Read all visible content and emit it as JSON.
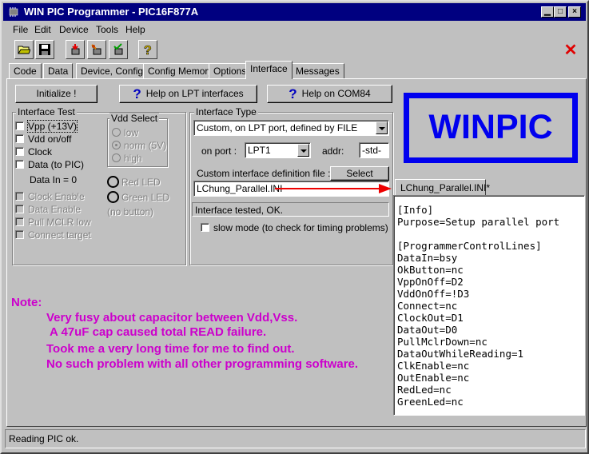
{
  "window": {
    "title": "WIN PIC Programmer - PIC16F877A"
  },
  "menu": [
    "File",
    "Edit",
    "Device",
    "Tools",
    "Help"
  ],
  "toolbar": {
    "icons": [
      "open-folder-icon",
      "save-disk-icon",
      "chip-read-icon",
      "chip-program-icon",
      "chip-verify-icon",
      "help-question-icon"
    ],
    "close_glyph": "✕"
  },
  "tabs": [
    "Code",
    "Data",
    "Device, Config",
    "Config Memory",
    "Options",
    "Interface",
    "Messages"
  ],
  "active_tab": "Interface",
  "buttons": {
    "initialize": "Initialize !",
    "help_lpt": "Help on LPT interfaces",
    "help_com": "Help on COM84",
    "select": "Select"
  },
  "interface_test": {
    "title": "Interface Test",
    "checks": [
      "Vpp (+13V)",
      "Vdd on/off",
      "Clock",
      "Data (to PIC)"
    ],
    "data_in": "Data In = 0",
    "disabled_checks": [
      "Clock Enable",
      "Data Enable",
      "Pull MCLR low",
      "Connect target"
    ]
  },
  "vdd_select": {
    "title": "Vdd Select",
    "options": [
      "low",
      "norm (5V)",
      "high"
    ],
    "selected": "norm (5V)"
  },
  "leds": {
    "red": "Red LED",
    "green": "Green LED",
    "no_button": "(no button)"
  },
  "interface_type": {
    "title": "Interface Type",
    "type_value": "Custom, on LPT port, defined by FILE",
    "on_port_label": "on port :",
    "port_value": "LPT1",
    "addr_label": "addr:",
    "addr_value": "-std-",
    "def_file_label": "Custom interface definition file :",
    "def_file_value": "LChung_Parallel.INI",
    "status": "Interface tested, OK.",
    "slow_mode": "slow mode (to check for timing problems)"
  },
  "logo": "WINPIC",
  "ini_tab": "LChung_Parallel.INI*",
  "ini_lines": [
    "[Info]",
    "Purpose=Setup parallel port",
    "",
    "[ProgrammerControlLines]",
    "DataIn=bsy",
    "OkButton=nc",
    "VppOnOff=D2",
    "VddOnOff=!D3",
    "Connect=nc",
    "ClockOut=D1",
    "DataOut=D0",
    "PullMclrDown=nc",
    "DataOutWhileReading=1",
    "ClkEnable=nc",
    "OutEnable=nc",
    "RedLed=nc",
    "GreenLed=nc"
  ],
  "note": {
    "title": "Note:",
    "lines": [
      "Very fusy about capacitor between Vdd,Vss.",
      "A 47uF cap caused total READ failure.",
      "Took me a very long time for me to find out.",
      "No such problem with all other programming software."
    ]
  },
  "statusbar": "Reading PIC ok.",
  "colors": {
    "title_bar": "#000080",
    "logo": "#0000ee",
    "note": "#cc00cc",
    "arrow": "#ee0000"
  }
}
